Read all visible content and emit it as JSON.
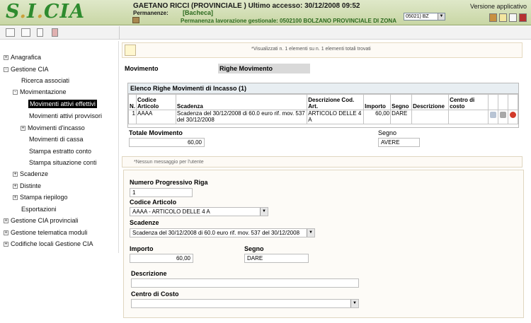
{
  "header": {
    "logo": "S.I.CIA",
    "user_line": "GAETANO RICCI (PROVINCIALE ) Ultimo accesso: 30/12/2008 09:52",
    "permanenza_label": "Permanenze:",
    "permanenza_value": "[Bacheca]",
    "permanenza_lavorazione": "Permanenza lavorazione gestionale: 0502100 BOLZANO PROVINCIALE DI ZONA",
    "province_select": "05021) BZ",
    "versione": "Versione applicativo"
  },
  "sidebar": {
    "items": [
      {
        "label": "Anagrafica",
        "toggle": "+"
      },
      {
        "label": "Gestione CIA",
        "toggle": "-"
      },
      {
        "label": "Ricerca associati",
        "toggle": ""
      },
      {
        "label": "Movimentazione",
        "toggle": "-"
      },
      {
        "label": "Movimenti attivi effettivi",
        "toggle": ""
      },
      {
        "label": "Movimenti attivi provvisori",
        "toggle": ""
      },
      {
        "label": "Movimenti d'incasso",
        "toggle": "+"
      },
      {
        "label": "Movimenti di cassa",
        "toggle": ""
      },
      {
        "label": "Stampa estratto conto",
        "toggle": ""
      },
      {
        "label": "Stampa situazione conti",
        "toggle": ""
      },
      {
        "label": "Scadenze",
        "toggle": "+"
      },
      {
        "label": "Distinte",
        "toggle": "+"
      },
      {
        "label": "Stampa riepilogo",
        "toggle": "+"
      },
      {
        "label": "Esportazioni",
        "toggle": ""
      },
      {
        "label": "Gestione CIA provinciali",
        "toggle": "+"
      },
      {
        "label": "Gestione telematica moduli",
        "toggle": "+"
      },
      {
        "label": "Codifiche locali Gestione CIA",
        "toggle": "+"
      }
    ]
  },
  "main": {
    "info_text": "*Visualizzati n. 1 elementi su n. 1 elementi totali trovati",
    "tab_movimento": "Movimento",
    "tab_righe": "Righe Movimento",
    "grid": {
      "title": "Elenco Righe Movimenti di Incasso (1)",
      "headers": [
        "N.",
        "Codice Articolo",
        "Scadenza",
        "Descrizione Cod. Art.",
        "Importo",
        "Segno",
        "Descrizione",
        "Centro di costo"
      ],
      "rows": [
        [
          "1",
          "AAAA",
          "Scadenza del 30/12/2008 di 60.0 euro rif. mov. 537 del 30/12/2008",
          "ARTICOLO DELLE 4 A",
          "60,00",
          "DARE",
          "",
          ""
        ]
      ]
    },
    "totale_label": "Totale Movimento",
    "totale_value": "60,00",
    "segno_label": "Segno",
    "segno_value": "AVERE",
    "message": "*Nessun messaggio per l'utente",
    "detail": {
      "num_label": "Numero Progressivo Riga",
      "num_value": "1",
      "codice_label": "Codice Articolo",
      "codice_value": "AAAA - ARTICOLO DELLE 4 A",
      "scadenze_label": "Scadenze",
      "scadenze_value": "Scadenza del 30/12/2008 di 60.0 euro rif. mov. 537 del 30/12/2008",
      "importo_label": "Importo",
      "importo_value": "60,00",
      "segno_label": "Segno",
      "segno_value": "DARE",
      "descrizione_label": "Descrizione",
      "descrizione_value": "",
      "centro_label": "Centro di Costo",
      "centro_value": ""
    }
  }
}
